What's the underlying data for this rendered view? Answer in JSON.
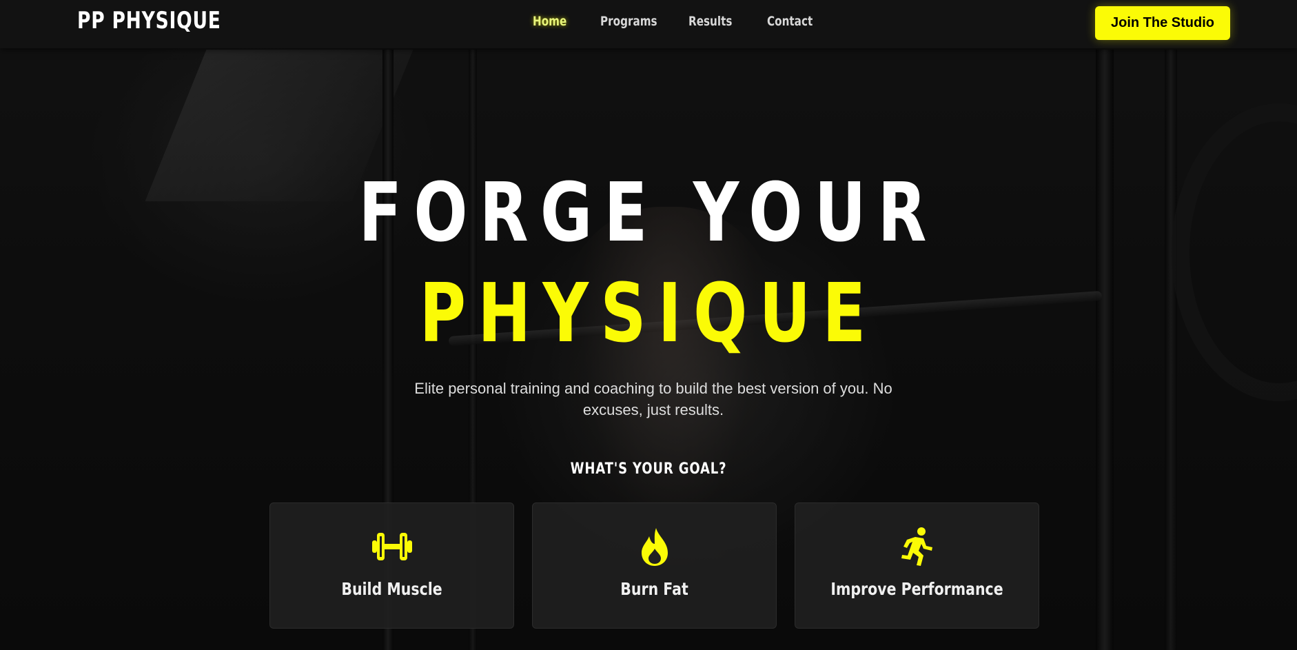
{
  "brand": {
    "logo": "PP PHYSIQUE"
  },
  "nav": {
    "links": [
      "Home",
      "Programs",
      "Results",
      "Contact"
    ],
    "active": "Home",
    "cta_label": "Join The Studio"
  },
  "hero": {
    "headline_line1": "FORGE YOUR",
    "headline_line2": "PHYSIQUE",
    "subtitle": "Elite personal training and coaching to build the best version of you. No excuses, just results.",
    "goal_title": "WHAT'S YOUR GOAL?",
    "goals": [
      {
        "label": "Build Muscle",
        "icon": "dumbbell-icon"
      },
      {
        "label": "Burn Fat",
        "icon": "flame-icon"
      },
      {
        "label": "Improve Performance",
        "icon": "running-person-icon"
      }
    ]
  },
  "colors": {
    "accent": "#fbfb06",
    "nav_bg": "#121212",
    "card_bg": "#202020",
    "active_link": "#e8f57a"
  }
}
